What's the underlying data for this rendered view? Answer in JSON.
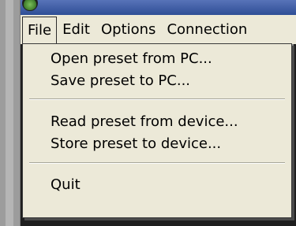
{
  "menubar": {
    "items": [
      {
        "label": "File"
      },
      {
        "label": "Edit"
      },
      {
        "label": "Options"
      },
      {
        "label": "Connection"
      }
    ],
    "active": "File"
  },
  "file_menu": {
    "items": [
      {
        "label": "Open preset from PC..."
      },
      {
        "label": "Save preset to PC..."
      },
      {
        "label": "Read preset from device..."
      },
      {
        "label": "Store preset to device..."
      },
      {
        "label": "Quit"
      }
    ]
  },
  "colors": {
    "menu_background": "#ece9d8",
    "title_bar": "#2f4e96",
    "content_background": "#1e1e1e"
  },
  "icons": {
    "app": "app-logo-icon"
  }
}
